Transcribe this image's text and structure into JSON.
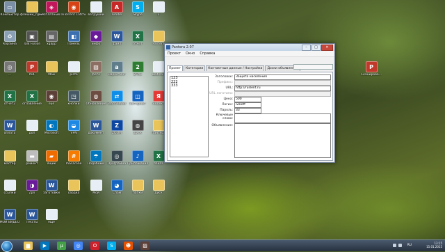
{
  "colors": {
    "folder": "#e9c45a",
    "word": "#2b579a",
    "excel": "#217346",
    "pdf": "#c0392b",
    "skype": "#00aff0",
    "opera": "#d0202a",
    "chrome": "#4285f4"
  },
  "desktop": {
    "icons": [
      {
        "label": "Компьютер",
        "icon": "computer-icon",
        "glyph": "▭",
        "color": "#7a8ea6"
      },
      {
        "label": "флешки_сделанные",
        "icon": "folder-icon",
        "glyph": "",
        "color": "#e9c45a"
      },
      {
        "label": "Бесплатный Поиск",
        "icon": "app-icon",
        "glyph": "◈",
        "color": "#c2185b"
      },
      {
        "label": "uTorrent Catcher",
        "icon": "app-icon",
        "glyph": "◉",
        "color": "#d84315"
      },
      {
        "label": "ватрушки",
        "icon": "document-icon",
        "glyph": "",
        "color": "#e8eef5"
      },
      {
        "label": "Adobe",
        "icon": "adobe-icon",
        "glyph": "A",
        "color": "#c62828"
      },
      {
        "label": "Skype",
        "icon": "skype-icon",
        "glyph": "S",
        "color": "#00aff0"
      },
      {
        "label": "2",
        "icon": "document-icon",
        "glyph": "",
        "color": "#e8eef5"
      },
      {
        "label": "Корзина",
        "icon": "recycle-bin-icon",
        "glyph": "♻",
        "color": "#8aa0b5"
      },
      {
        "label": "Talk Fusion",
        "icon": "app-icon",
        "glyph": "▣",
        "color": "#555"
      },
      {
        "label": "xgapp",
        "icon": "app-icon",
        "glyph": "▤",
        "color": "#666"
      },
      {
        "label": "Панель",
        "icon": "control-panel-icon",
        "glyph": "◧",
        "color": "#3b6fb0"
      },
      {
        "label": "инфо",
        "icon": "app-icon",
        "glyph": "◆",
        "color": "#6a1b9a"
      },
      {
        "label": "файл",
        "icon": "word-icon",
        "glyph": "W",
        "color": "#2b579a"
      },
      {
        "label": "отчёт",
        "icon": "excel-icon",
        "glyph": "X",
        "color": "#217346"
      },
      {
        "label": "Pantera",
        "icon": "folder-icon",
        "glyph": "",
        "color": "#e9c45a"
      },
      {
        "label": "...",
        "icon": "app-icon",
        "glyph": "◎",
        "color": "#777"
      },
      {
        "label": "PDF",
        "icon": "pdf-icon",
        "glyph": "P",
        "color": "#c0392b"
      },
      {
        "label": "Мои",
        "icon": "folder-icon",
        "glyph": "",
        "color": "#e9c45a"
      },
      {
        "label": "pinfo",
        "icon": "document-icon",
        "glyph": "",
        "color": "#e8eef5"
      },
      {
        "label": "фото",
        "icon": "image-icon",
        "glyph": "▨",
        "color": "#8d6e63"
      },
      {
        "label": "маркетинг",
        "icon": "app-icon",
        "glyph": "a",
        "color": "#607d8b"
      },
      {
        "label": "2ГИС",
        "icon": "map-icon",
        "glyph": "2",
        "color": "#2e7d32"
      },
      {
        "label": "шаблон",
        "icon": "document-icon",
        "glyph": "",
        "color": "#e8eef5"
      },
      {
        "label": "отчёт2",
        "icon": "excel-icon",
        "glyph": "X",
        "color": "#217346"
      },
      {
        "label": "оглавление",
        "icon": "excel-icon",
        "glyph": "X",
        "color": "#217346"
      },
      {
        "label": "eye",
        "icon": "image-icon",
        "glyph": "◉",
        "color": "#5d4037"
      },
      {
        "label": "кнопки",
        "icon": "app-icon",
        "glyph": "◳",
        "color": "#455a64"
      },
      {
        "label": "Обновление",
        "icon": "app-icon",
        "glyph": "◍",
        "color": "#6d4c41"
      },
      {
        "label": "TeamViewer",
        "icon": "teamviewer-icon",
        "glyph": "⇄",
        "color": "#0e8ee9"
      },
      {
        "label": "Интернет",
        "icon": "app-icon",
        "glyph": "◫",
        "color": "#1565c0"
      },
      {
        "label": "Яндекс",
        "icon": "app-icon",
        "glyph": "Я",
        "color": "#e53935"
      },
      {
        "label": "оплата",
        "icon": "word-icon",
        "glyph": "W",
        "color": "#2b579a"
      },
      {
        "label": "доп",
        "icon": "document-icon",
        "glyph": "",
        "color": "#e8eef5"
      },
      {
        "label": "Microsoft",
        "icon": "app-icon",
        "glyph": "◐",
        "color": "#0277bd"
      },
      {
        "label": "VPN",
        "icon": "app-icon",
        "glyph": "◒",
        "color": "#1e88e5"
      },
      {
        "label": "документ",
        "icon": "word-icon",
        "glyph": "W",
        "color": "#2b579a"
      },
      {
        "label": "ZOOM",
        "icon": "app-icon",
        "glyph": "Z",
        "color": "#0d47a1"
      },
      {
        "label": "Диск",
        "icon": "disk-icon",
        "glyph": "◍",
        "color": "#444"
      },
      {
        "label": "Пантера",
        "icon": "folder-icon",
        "glyph": "",
        "color": "#e9c45a"
      },
      {
        "label": "мастер",
        "icon": "folder-icon",
        "glyph": "",
        "color": "#e9c45a"
      },
      {
        "label": "ремонт",
        "icon": "app-icon",
        "glyph": "▬",
        "color": "#bdbdbd"
      },
      {
        "label": "ящик",
        "icon": "app-icon",
        "glyph": "▰",
        "color": "#ef6c00"
      },
      {
        "label": "mGOZone",
        "icon": "app-icon",
        "glyph": "#",
        "color": "#f57c00"
      },
      {
        "label": "Подобный",
        "icon": "app-icon",
        "glyph": "☂",
        "color": "#0277bd"
      },
      {
        "label": "Программа",
        "icon": "app-icon",
        "glyph": "◎",
        "color": "#37474f"
      },
      {
        "label": "Приложения",
        "icon": "music-icon",
        "glyph": "♪",
        "color": "#1565c0"
      },
      {
        "label": "заказ",
        "icon": "excel-icon",
        "glyph": "X",
        "color": "#217346"
      },
      {
        "label": "ссылки",
        "icon": "document-icon",
        "glyph": "",
        "color": "#e8eef5"
      },
      {
        "label": "Zpn",
        "icon": "app-icon",
        "glyph": "◑",
        "color": "#6a1b9a"
      },
      {
        "label": "заготовки",
        "icon": "word-icon",
        "glyph": "W",
        "color": "#2b579a"
      },
      {
        "label": "сводка",
        "icon": "folder-icon",
        "glyph": "",
        "color": "#e9c45a"
      },
      {
        "label": "Мой",
        "icon": "document-icon",
        "glyph": "",
        "color": "#e8eef5"
      },
      {
        "label": "Спам",
        "icon": "app-icon",
        "glyph": "◕",
        "color": "#1565c0"
      },
      {
        "label": "папки",
        "icon": "folder-icon",
        "glyph": "",
        "color": "#e9c45a"
      },
      {
        "label": "диск",
        "icon": "folder-icon",
        "glyph": "",
        "color": "#e9c45a"
      },
      {
        "label": "МОИ ВИДЕО",
        "icon": "word-icon",
        "glyph": "W",
        "color": "#2b579a"
      },
      {
        "label": "Тексты",
        "icon": "word-icon",
        "glyph": "W",
        "color": "#2b579a"
      },
      {
        "label": "ещё",
        "icon": "document-icon",
        "glyph": "",
        "color": "#e8eef5"
      },
      {
        "label": "Сканирова...",
        "icon": "pdf-icon",
        "glyph": "P",
        "color": "#c0392b"
      }
    ]
  },
  "window": {
    "title": "Pantera 2.07",
    "menu": [
      "Проект",
      "Окно",
      "Справка"
    ],
    "tabs": [
      "Проект",
      "Категории",
      "Контактные данные / Настройки",
      "Доски объявлений"
    ],
    "list": [
      "123",
      "222",
      "333"
    ],
    "form": [
      {
        "label": "Заголовок:",
        "value": "Защита населения",
        "state": "normal"
      },
      {
        "label": "Префикс:",
        "value": "",
        "state": "disabled"
      },
      {
        "label": "URL:",
        "value": "http://ruslent.ru",
        "state": "normal"
      },
      {
        "label": "URL логотипа:",
        "value": "",
        "state": "disabled"
      },
      {
        "label": "Цена:",
        "value": "500",
        "state": "normal"
      },
      {
        "label": "Логин:",
        "value": "ivaleff",
        "state": "normal"
      },
      {
        "label": "Пароль:",
        "value": "33",
        "state": "normal"
      },
      {
        "label": "Ключевые слова:",
        "value": "",
        "state": "normal"
      },
      {
        "label": "Объявление:",
        "value": "",
        "state": "normal"
      }
    ]
  },
  "taskbar": {
    "apps": [
      {
        "name": "explorer",
        "icon": "folder-icon",
        "glyph": "▆",
        "color": "#e9c45a"
      },
      {
        "name": "media",
        "icon": "media-icon",
        "glyph": "▶",
        "color": "#0277bd"
      },
      {
        "name": "utorrent",
        "icon": "utorrent-icon",
        "glyph": "µ",
        "color": "#43a047"
      },
      {
        "name": "chrome",
        "icon": "chrome-icon",
        "glyph": "◎",
        "color": "#4285f4"
      },
      {
        "name": "opera",
        "icon": "opera-icon",
        "glyph": "O",
        "color": "#d0202a"
      },
      {
        "name": "skype",
        "icon": "skype-icon",
        "glyph": "S",
        "color": "#00aff0"
      },
      {
        "name": "pantera",
        "icon": "pantera-icon",
        "glyph": "☻",
        "color": "#e65100"
      },
      {
        "name": "image",
        "icon": "image-icon",
        "glyph": "▨",
        "color": "#5d4037"
      }
    ],
    "lang": "RU",
    "time": "13:15",
    "date": "15.01.2015"
  }
}
